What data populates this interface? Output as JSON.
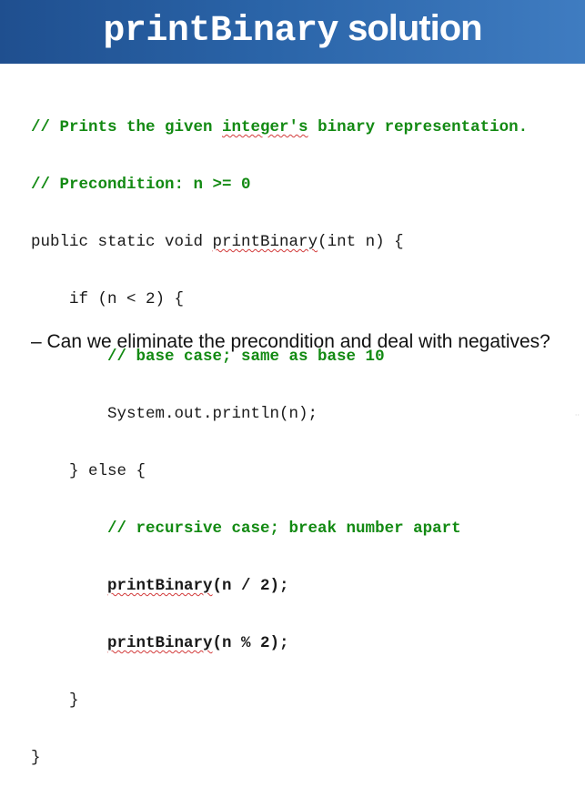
{
  "slide": {
    "title_code": "printBinary",
    "title_text": " solution",
    "code_lines": {
      "l1_comment_a": "// Prints the given ",
      "l1_comment_word": "integer's",
      "l1_comment_b": " binary representation.",
      "l2_comment": "// Precondition: n >= 0",
      "l3_a": "public static void ",
      "l3_method": "printBinary",
      "l3_b": "(int n) {",
      "l4": "    if (n < 2) {",
      "l5_indent": "        ",
      "l5_comment": "// base case; same as base 10",
      "l6": "        System.out.println(n);",
      "l7": "    } else {",
      "l8_indent": "        ",
      "l8_comment": "// recursive case; break number apart",
      "l9_indent": "        ",
      "l9_method": "printBinary",
      "l9_args": "(n / 2);",
      "l10_indent": "        ",
      "l10_method": "printBinary",
      "l10_args": "(n % 2);",
      "l11": "    }",
      "l12": "}"
    },
    "bullet": "– Can we eliminate the precondition and deal with negatives?",
    "footer_mark": "··"
  },
  "colors": {
    "header_start": "#1f4f8f",
    "header_end": "#3f7cc1",
    "comment_green": "#138a13",
    "spell_underline": "#d23b3b"
  }
}
